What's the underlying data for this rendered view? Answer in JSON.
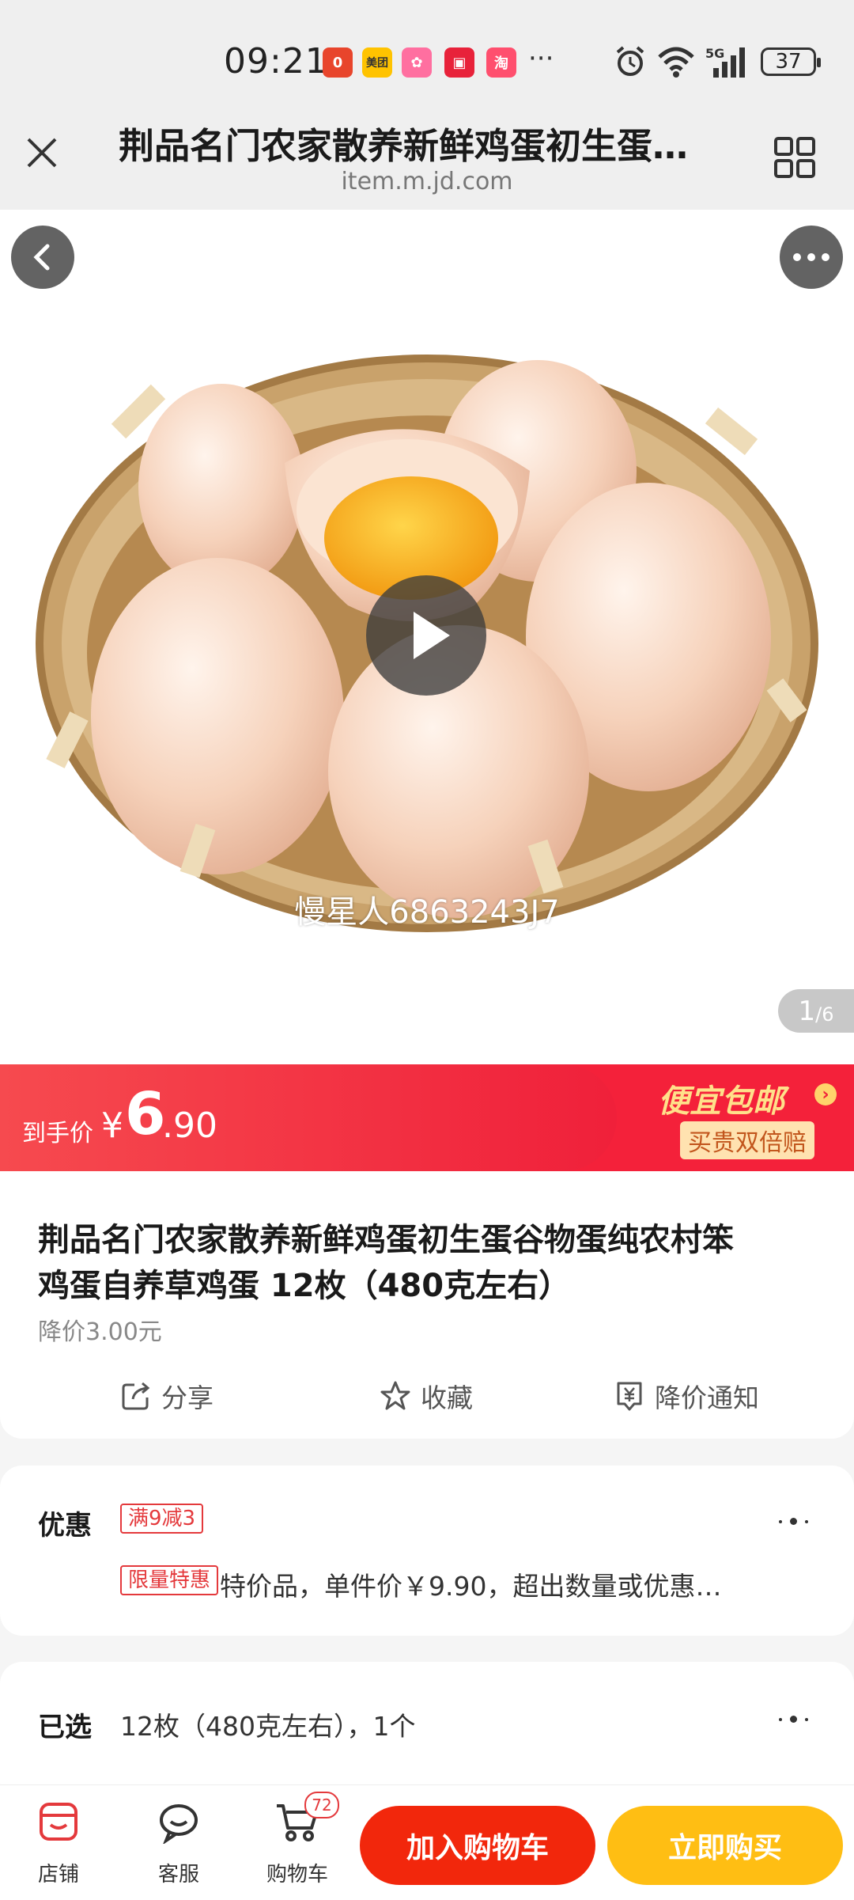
{
  "status_bar": {
    "time": "09:21",
    "overflow": "···",
    "network": "5G",
    "battery": "37",
    "notification_icons": [
      {
        "name": "app-badge-icon",
        "glyph": "0",
        "color": "#e8452c"
      },
      {
        "name": "meituan-icon",
        "glyph": "美团",
        "color": "#ffc300"
      },
      {
        "name": "game-app-icon",
        "glyph": "✿",
        "color": "#ff6fa0"
      },
      {
        "name": "red-book-icon",
        "glyph": "▣",
        "color": "#e8223a"
      },
      {
        "name": "taobao-icon",
        "glyph": "淘",
        "color": "#ff4f6e"
      }
    ]
  },
  "header": {
    "title": "荆品名门农家散养新鲜鸡蛋初生蛋…",
    "url": "item.m.jd.com"
  },
  "gallery": {
    "watermark": "慢星人6863243J7",
    "counter_current": "1",
    "counter_total": "/6"
  },
  "price": {
    "label": "到手价",
    "currency": "¥",
    "integer": "6",
    "decimal": ".90",
    "promo_main": "便宜包邮",
    "promo_sub": "买贵双倍赔"
  },
  "product": {
    "name_line1": "荆品名门农家散养新鲜鸡蛋初生蛋谷物蛋纯农村笨",
    "name_line2": "鸡蛋自养草鸡蛋 12枚（480克左右）",
    "price_drop": "降价3.00元",
    "actions": {
      "share": "分享",
      "favorite": "收藏",
      "notify": "降价通知"
    }
  },
  "discount": {
    "label": "优惠",
    "tag": "满9减3",
    "limited_tag": "限量特惠",
    "description": "特价品，单件价￥9.90，超出数量或优惠…"
  },
  "selected": {
    "label": "已选",
    "value": "12枚（480克左右），1个"
  },
  "bottom_nav": {
    "shop": "店铺",
    "service": "客服",
    "cart": "购物车",
    "cart_count": "72",
    "add_to_cart": "加入购物车",
    "buy_now": "立即购买"
  },
  "colors": {
    "accent_red": "#f2270c",
    "accent_yellow": "#ffbe13",
    "banner_red": "#f4213a"
  }
}
